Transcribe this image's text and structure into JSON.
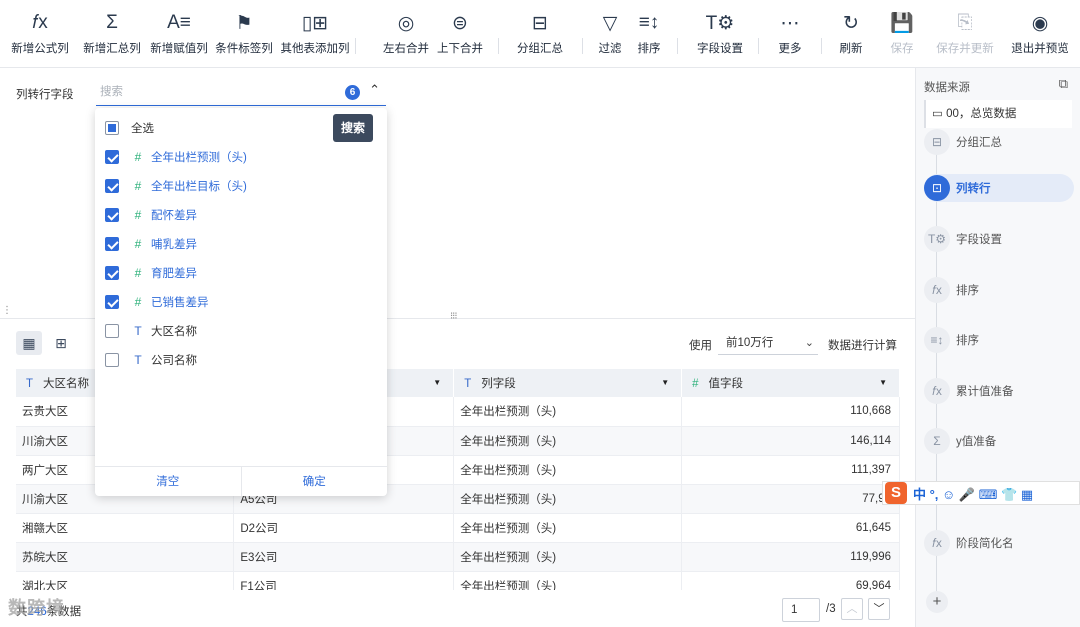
{
  "toolbar": {
    "items": [
      {
        "icon": "fx-icon",
        "glyph": "𝑓x",
        "label": "新增公式列",
        "enabled": true
      },
      {
        "icon": "sigma-icon",
        "glyph": "Σ",
        "label": "新增汇总列",
        "enabled": true
      },
      {
        "icon": "assign-icon",
        "glyph": "A≡",
        "label": "新增赋值列",
        "enabled": true
      },
      {
        "icon": "flag-icon",
        "glyph": "⚑",
        "label": "条件标签列",
        "enabled": true
      },
      {
        "icon": "table-add-icon",
        "glyph": "▯⊞",
        "label": "其他表添加列",
        "enabled": true
      },
      {
        "icon": "merge-lr-icon",
        "glyph": "◎",
        "label": "左右合并",
        "enabled": true
      },
      {
        "icon": "merge-tb-icon",
        "glyph": "⊜",
        "label": "上下合并",
        "enabled": true
      },
      {
        "icon": "group-icon",
        "glyph": "⊟",
        "label": "分组汇总",
        "enabled": true
      },
      {
        "icon": "filter-icon",
        "glyph": "▽",
        "label": "过滤",
        "enabled": true
      },
      {
        "icon": "sort-icon",
        "glyph": "≡↕",
        "label": "排序",
        "enabled": true
      },
      {
        "icon": "field-settings-icon",
        "glyph": "T⚙",
        "label": "字段设置",
        "enabled": true
      },
      {
        "icon": "more-icon",
        "glyph": "⋯",
        "label": "更多",
        "enabled": true
      },
      {
        "icon": "refresh-icon",
        "glyph": "↻",
        "label": "刷新",
        "enabled": true
      },
      {
        "icon": "save-icon",
        "glyph": "💾",
        "label": "保存",
        "enabled": false
      },
      {
        "icon": "save-update-icon",
        "glyph": "⎘",
        "label": "保存并更新",
        "enabled": false
      },
      {
        "icon": "exit-preview-icon",
        "glyph": "◉",
        "label": "退出并预览",
        "enabled": true
      }
    ]
  },
  "config": {
    "field_label": "列转行字段",
    "search_placeholder": "搜索",
    "selected_count": "6"
  },
  "dropdown": {
    "search_button": "搜索",
    "select_all": "全选",
    "items": [
      {
        "type": "num",
        "label": "全年出栏预测（头)",
        "checked": true
      },
      {
        "type": "num",
        "label": "全年出栏目标（头)",
        "checked": true
      },
      {
        "type": "num",
        "label": "配怀差异",
        "checked": true
      },
      {
        "type": "num",
        "label": "哺乳差异",
        "checked": true
      },
      {
        "type": "num",
        "label": "育肥差异",
        "checked": true
      },
      {
        "type": "num",
        "label": "已销售差异",
        "checked": true
      },
      {
        "type": "txt",
        "label": "大区名称",
        "checked": false
      },
      {
        "type": "txt",
        "label": "公司名称",
        "checked": false
      }
    ],
    "clear_label": "清空",
    "confirm_label": "确定"
  },
  "options": {
    "use_label": "使用",
    "rows_value": "前10万行",
    "calc_label": "数据进行计算"
  },
  "table": {
    "columns": [
      {
        "type": "txt",
        "label": "大区名称"
      },
      {
        "type": "txt",
        "label": ""
      },
      {
        "type": "txt",
        "label": "列字段"
      },
      {
        "type": "num",
        "label": "值字段"
      }
    ],
    "rows": [
      [
        "云贵大区",
        "",
        "全年出栏预测（头)",
        "110,668"
      ],
      [
        "川渝大区",
        "",
        "全年出栏预测（头)",
        "146,114"
      ],
      [
        "两广大区",
        "",
        "全年出栏预测（头)",
        "111,397"
      ],
      [
        "川渝大区",
        "A5公司",
        "全年出栏预测（头)",
        "77,92"
      ],
      [
        "湘赣大区",
        "D2公司",
        "全年出栏预测（头)",
        "61,645"
      ],
      [
        "苏皖大区",
        "E3公司",
        "全年出栏预测（头)",
        "119,996"
      ],
      [
        "湖北大区",
        "F1公司",
        "全年出栏预测（头)",
        "69,964"
      ]
    ]
  },
  "footer": {
    "total_prefix": "共",
    "total_count": "246",
    "total_suffix": "条数据",
    "page_value": "1",
    "page_total": "/3"
  },
  "watermark": "数跨境",
  "right_panel": {
    "title": "数据来源",
    "source": "00，总览数据",
    "steps": [
      {
        "icon": "group-icon",
        "glyph": "⊟",
        "label": "分组汇总",
        "active": false
      },
      {
        "icon": "unpivot-icon",
        "glyph": "⊡",
        "label": "列转行",
        "active": true
      },
      {
        "icon": "field-settings-icon",
        "glyph": "T⚙",
        "label": "字段设置",
        "active": false
      },
      {
        "icon": "fx-icon",
        "glyph": "𝑓x",
        "label": "排序",
        "active": false
      },
      {
        "icon": "sort-icon",
        "glyph": "≡↕",
        "label": "排序",
        "active": false
      },
      {
        "icon": "fx-icon",
        "glyph": "𝑓x",
        "label": "累计值准备",
        "active": false
      },
      {
        "icon": "sigma-icon",
        "glyph": "Σ",
        "label": "y值准备",
        "active": false
      },
      {
        "icon": "fx-icon",
        "glyph": "𝑓x",
        "label": "阶段简化名",
        "active": false
      }
    ]
  },
  "ime": {
    "logo": "S",
    "text": "中 °, ☺ 🎤 ⌨ 👕 ▦"
  }
}
